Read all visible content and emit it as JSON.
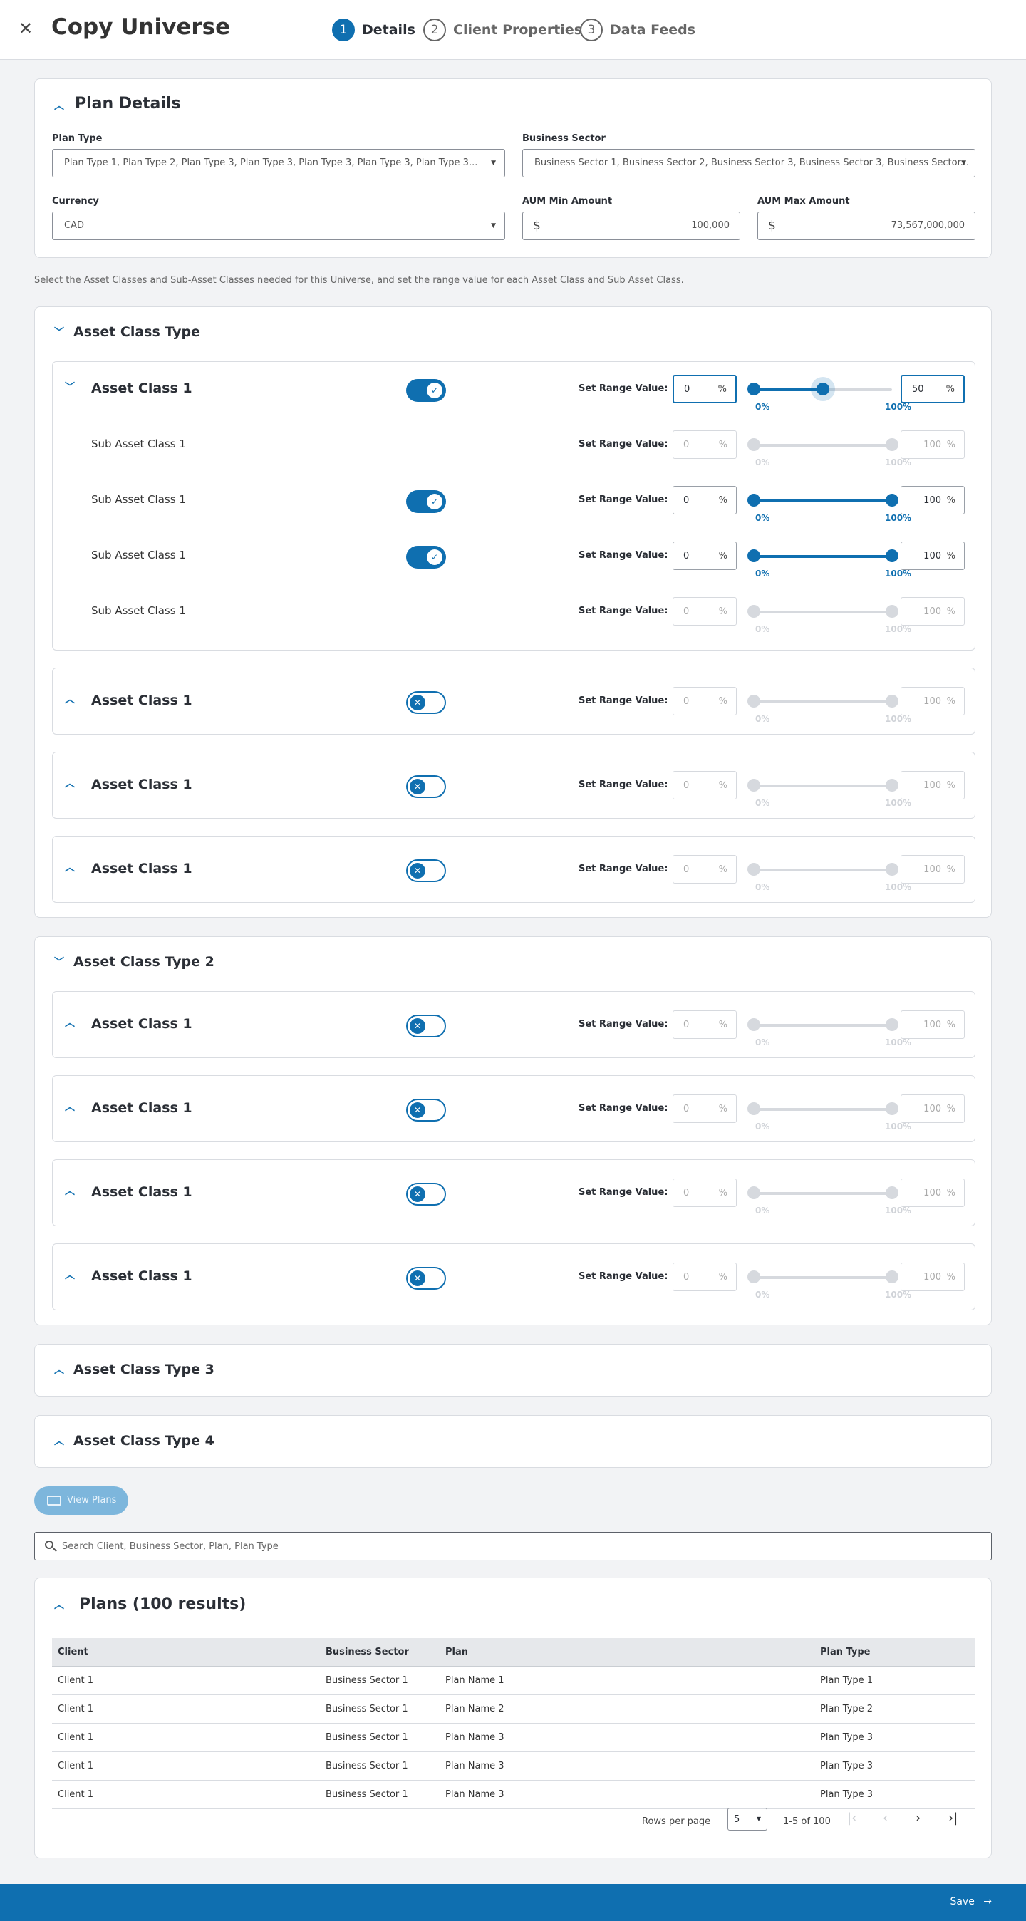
{
  "header": {
    "title": "Copy Universe",
    "steps": [
      {
        "num": "1",
        "label": "Details"
      },
      {
        "num": "2",
        "label": "Client Properties"
      },
      {
        "num": "3",
        "label": "Data Feeds"
      }
    ]
  },
  "plan_details": {
    "title": "Plan Details",
    "plan_type_label": "Plan Type",
    "plan_type_value": "Plan Type 1, Plan Type 2, Plan Type 3, Plan Type 3, Plan Type 3, Plan Type 3, Plan Type 3...",
    "business_sector_label": "Business Sector",
    "business_sector_value": "Business Sector 1, Business Sector 2, Business Sector 3, Business Sector 3, Business Sector...",
    "currency_label": "Currency",
    "currency_value": "CAD",
    "aum_min_label": "AUM Min Amount",
    "aum_min_value": "100,000",
    "aum_max_label": "AUM Max Amount",
    "aum_max_value": "73,567,000,000",
    "currency_symbol": "$"
  },
  "help_text": "Select the Asset Classes and Sub-Asset Classes needed for this Universe, and set the range value for each Asset Class and Sub Asset Class.",
  "common": {
    "set_range_label": "Set Range Value:",
    "pct": "%",
    "zero_label": "0%",
    "hundred_label": "100%"
  },
  "asset_type_1": {
    "title": "Asset Class Type",
    "rows": [
      {
        "name": "Asset Class 1",
        "min": "0",
        "max": "50"
      },
      {
        "name": "Sub Asset Class 1",
        "min": "0",
        "max": "100"
      },
      {
        "name": "Sub Asset Class 1",
        "min": "0",
        "max": "100"
      },
      {
        "name": "Sub Asset Class 1",
        "min": "0",
        "max": "100"
      },
      {
        "name": "Sub Asset Class 1",
        "min": "0",
        "max": "100"
      }
    ],
    "collapsed": [
      {
        "name": "Asset Class 1",
        "min": "0",
        "max": "100"
      },
      {
        "name": "Asset Class 1",
        "min": "0",
        "max": "100"
      },
      {
        "name": "Asset Class 1",
        "min": "0",
        "max": "100"
      }
    ]
  },
  "asset_type_2": {
    "title": "Asset Class Type 2",
    "collapsed": [
      {
        "name": "Asset Class 1",
        "min": "0",
        "max": "100"
      },
      {
        "name": "Asset Class 1",
        "min": "0",
        "max": "100"
      },
      {
        "name": "Asset Class 1",
        "min": "0",
        "max": "100"
      },
      {
        "name": "Asset Class 1",
        "min": "0",
        "max": "100"
      }
    ]
  },
  "asset_type_3": {
    "title": "Asset Class Type 3"
  },
  "asset_type_4": {
    "title": "Asset Class Type 4"
  },
  "view_plans_label": "View Plans",
  "search": {
    "placeholder": "Search Client, Business Sector, Plan, Plan Type"
  },
  "plans": {
    "title": "Plans (100 results)",
    "columns": [
      "Client",
      "Business Sector",
      "Plan",
      "Plan Type"
    ],
    "rows": [
      [
        "Client 1",
        "Business Sector 1",
        "Plan Name 1",
        "Plan Type 1"
      ],
      [
        "Client 1",
        "Business Sector 1",
        "Plan Name 2",
        "Plan Type 2"
      ],
      [
        "Client 1",
        "Business Sector 1",
        "Plan Name 3",
        "Plan Type 3"
      ],
      [
        "Client 1",
        "Business Sector 1",
        "Plan Name 3",
        "Plan Type 3"
      ],
      [
        "Client 1",
        "Business Sector 1",
        "Plan Name 3",
        "Plan Type 3"
      ]
    ],
    "rows_per_page_label": "Rows per page",
    "rows_per_page_value": "5",
    "range_text": "1-5 of 100"
  },
  "footer": {
    "save_label": "Save"
  }
}
